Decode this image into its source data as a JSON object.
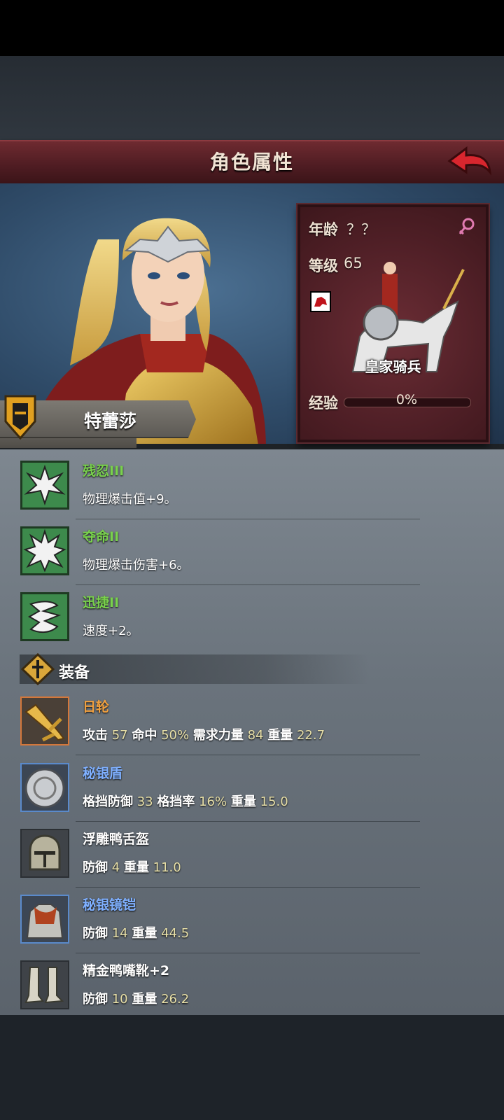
{
  "header": {
    "title": "角色属性"
  },
  "character": {
    "name": "特蕾莎",
    "age_label": "年龄",
    "age_value": "？？",
    "level_label": "等级",
    "level_value": "65",
    "class_name": "皇家骑兵",
    "exp_label": "经验",
    "exp_value": "0%",
    "gender_icon": "female-icon"
  },
  "skills": [
    {
      "name": "残忍III",
      "desc": "物理爆击值+9。",
      "icon": "burst-icon"
    },
    {
      "name": "夺命II",
      "desc": "物理爆击伤害+6。",
      "icon": "burst-icon"
    },
    {
      "name": "迅捷II",
      "desc": "速度+2。",
      "icon": "wing-icon"
    }
  ],
  "equipment_section": {
    "title": "装备"
  },
  "equipment": [
    {
      "name": "日轮",
      "rarity": "orange",
      "icon": "sword-icon",
      "stats": [
        {
          "label": "攻击",
          "value": "57"
        },
        {
          "label": "命中",
          "value": "50%"
        },
        {
          "label": "需求力量",
          "value": "84"
        },
        {
          "label": "重量",
          "value": "22.7"
        }
      ]
    },
    {
      "name": "秘银盾",
      "rarity": "blue",
      "icon": "shield-icon",
      "stats": [
        {
          "label": "格挡防御",
          "value": "33"
        },
        {
          "label": "格挡率",
          "value": "16%"
        },
        {
          "label": "重量",
          "value": "15.0"
        }
      ]
    },
    {
      "name": "浮雕鸭舌盔",
      "rarity": "white",
      "icon": "helmet-icon",
      "stats": [
        {
          "label": "防御",
          "value": "4"
        },
        {
          "label": "重量",
          "value": "11.0"
        }
      ]
    },
    {
      "name": "秘银镜铠",
      "rarity": "blue",
      "icon": "armor-icon",
      "stats": [
        {
          "label": "防御",
          "value": "14"
        },
        {
          "label": "重量",
          "value": "44.5"
        }
      ]
    },
    {
      "name": "精金鸭嘴靴+2",
      "rarity": "white",
      "icon": "boots-icon",
      "stats": [
        {
          "label": "防御",
          "value": "10"
        },
        {
          "label": "重量",
          "value": "26.2"
        }
      ]
    }
  ],
  "colors": {
    "skill_name": "#79d14d",
    "rare_orange": "#f0a040",
    "rare_blue": "#7fb0ff",
    "stat_value": "#e8e0a8"
  }
}
